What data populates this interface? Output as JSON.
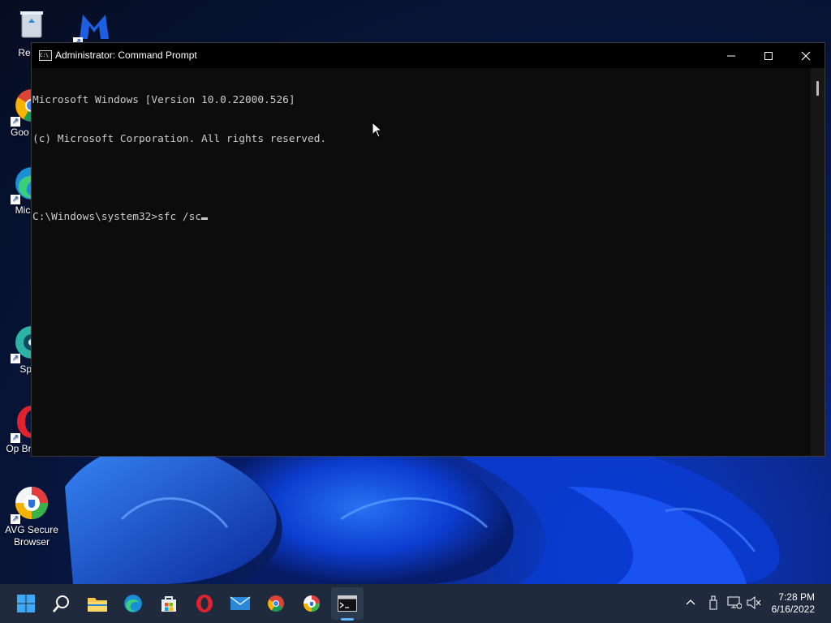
{
  "desktop": {
    "icons": [
      {
        "label": "Recyc",
        "name": "recycle-bin"
      },
      {
        "label": "Goo Chro",
        "name": "google-chrome"
      },
      {
        "label": "Micr Ed",
        "name": "microsoft-edge"
      },
      {
        "label": "SpyH",
        "name": "spyhunter"
      },
      {
        "label": "Op Browser",
        "name": "opera-browser"
      },
      {
        "label": "AVG Secure Browser",
        "name": "avg-secure-browser"
      }
    ]
  },
  "window": {
    "title": "Administrator: Command Prompt",
    "icon_text": "C:\\",
    "minimize": "—",
    "maximize": "☐",
    "close": "✕",
    "lines": [
      "Microsoft Windows [Version 10.0.22000.526]",
      "(c) Microsoft Corporation. All rights reserved.",
      "",
      "C:\\Windows\\system32>sfc /sc"
    ]
  },
  "taskbar": {
    "apps": [
      "start",
      "search",
      "file-explorer",
      "edge",
      "store",
      "opera",
      "mail",
      "chrome",
      "avg-browser",
      "command-prompt"
    ],
    "tray": {
      "chevron": "^",
      "time": "7:28 PM",
      "date": "6/16/2022"
    }
  },
  "colors": {
    "console_bg": "#0c0c0c",
    "console_text": "#cccccc",
    "taskbar_bg": "#1f2b3d",
    "active_indicator": "#5ab4ff"
  }
}
